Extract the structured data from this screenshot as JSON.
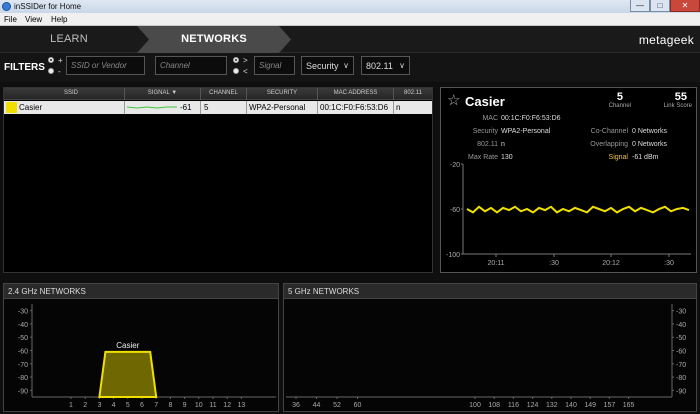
{
  "window": {
    "title": "inSSIDer for Home",
    "min": "—",
    "max": "□",
    "close": "✕"
  },
  "menu": [
    {
      "label": "File"
    },
    {
      "label": "View"
    },
    {
      "label": "Help"
    }
  ],
  "nav": {
    "tabs": [
      {
        "label": "LEARN"
      },
      {
        "label": "NETWORKS"
      }
    ],
    "logo": "metageek"
  },
  "filters": {
    "label": "FILTERS",
    "plus": "+",
    "minus": "-",
    "gt": ">",
    "lt": "<",
    "ssid_placeholder": "SSID or Vendor",
    "channel_placeholder": "Channel",
    "signal_placeholder": "Signal",
    "security_label": "Security",
    "standard_label": "802.11",
    "chevron": "∨"
  },
  "table": {
    "headers": [
      "SSID",
      "SIGNAL ▼",
      "CHANNEL",
      "SECURITY",
      "MAC ADDRESS",
      "802.11"
    ],
    "rows": [
      {
        "ssid": "Casier",
        "signal": "-61",
        "signal_fraction": 0.55,
        "channel": "5",
        "security": "WPA2-Personal",
        "mac": "00:1C:F0:F6:53:D6",
        "standard": "n",
        "color": "#f0e000"
      }
    ]
  },
  "detail": {
    "name": "Casier",
    "star": "☆",
    "channel_value": "5",
    "channel_label": "Channel",
    "link_score_value": "55",
    "link_score_label": "Link Score",
    "mac_label": "MAC",
    "mac_value": "00:1C:F0:F6:53:D6",
    "security_label": "Security",
    "security_value": "WPA2-Personal",
    "standard_label": "802.11",
    "standard_value": "n",
    "maxrate_label": "Max Rate",
    "maxrate_value": "130",
    "cochannel_label": "Co-Channel",
    "cochannel_value": "0 Networks",
    "overlapping_label": "Overlapping",
    "overlapping_value": "0 Networks",
    "signal_label": "Signal",
    "signal_value": "-61 dBm",
    "accent": "#f0c040"
  },
  "chart_data": [
    {
      "type": "line",
      "y_tick_labels": [
        "-20",
        "-60",
        "-100"
      ],
      "ylim": [
        -100,
        -20
      ],
      "x_tick_labels": [
        "20:11",
        ":30",
        "20:12",
        ":30"
      ],
      "series": [
        {
          "values": [
            -60,
            -63,
            -58,
            -62,
            -59,
            -63,
            -59,
            -61,
            -58,
            -62,
            -60,
            -63,
            -59,
            -61,
            -58,
            -63,
            -60,
            -62,
            -59,
            -61,
            -63,
            -58,
            -60,
            -62,
            -59,
            -63,
            -60,
            -58,
            -62,
            -59,
            -61,
            -63,
            -60,
            -58,
            -62,
            -60,
            -59,
            -61
          ],
          "color": "#f0e000"
        }
      ]
    },
    {
      "type": "area",
      "title": "2.4 GHz NETWORKS",
      "y_tick_labels": [
        "-30",
        "-40",
        "-50",
        "-60",
        "-70",
        "-80",
        "-90"
      ],
      "ylim": [
        -95,
        -25
      ],
      "x_tick_labels": [
        "1",
        "2",
        "3",
        "4",
        "5",
        "6",
        "7",
        "8",
        "9",
        "10",
        "11",
        "12",
        "13"
      ],
      "series": [
        {
          "name": "Casier",
          "channel": 5,
          "span": [
            3,
            7
          ],
          "signal": -61,
          "color": "#f0e000"
        }
      ]
    },
    {
      "type": "area",
      "title": "5 GHz NETWORKS",
      "y_tick_labels": [
        "-30",
        "-40",
        "-50",
        "-60",
        "-70",
        "-80",
        "-90"
      ],
      "ylim": [
        -95,
        -25
      ],
      "x_tick_labels": [
        "36",
        "44",
        "52",
        "60",
        "100",
        "108",
        "116",
        "124",
        "132",
        "140",
        "149",
        "157",
        "165"
      ],
      "series": []
    }
  ]
}
